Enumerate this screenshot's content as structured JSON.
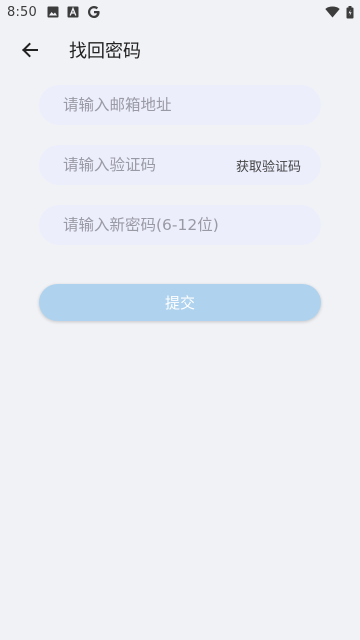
{
  "status_bar": {
    "time": "8:50",
    "icons_left": [
      "image-icon",
      "text-a-icon",
      "google-g-icon"
    ],
    "icons_right": [
      "wifi-icon",
      "battery-icon"
    ]
  },
  "header": {
    "title": "找回密码",
    "back_icon": "arrow-left-icon"
  },
  "form": {
    "email_placeholder": "请输入邮箱地址",
    "code_placeholder": "请输入验证码",
    "get_code_label": "获取验证码",
    "password_placeholder": "请输入新密码(6-12位)"
  },
  "submit_label": "提交",
  "colors": {
    "background": "#f1f2f6",
    "field_bg": "#eceefc",
    "submit_bg": "#afd3ee"
  }
}
